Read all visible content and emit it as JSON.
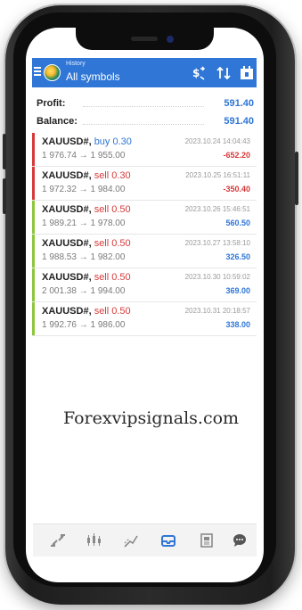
{
  "header": {
    "subtitle": "History",
    "title": "All symbols",
    "actions": [
      "currency-exchange-icon",
      "sort-icon",
      "calendar-icon"
    ]
  },
  "summary": {
    "profit_label": "Profit:",
    "profit_value": "591.40",
    "balance_label": "Balance:",
    "balance_value": "591.40"
  },
  "trades": [
    {
      "symbol": "XAUUSD#,",
      "side": "buy 0.30",
      "side_type": "buy",
      "prices": "1 976.74 → 1 955.00",
      "time": "2023.10.24 14:04:43",
      "profit": "-652.20",
      "profit_color": "#d63a3a",
      "bar_color": "#d63a3a"
    },
    {
      "symbol": "XAUUSD#,",
      "side": "sell 0.30",
      "side_type": "sell",
      "prices": "1 972.32 → 1 984.00",
      "time": "2023.10.25 16:51:11",
      "profit": "-350.40",
      "profit_color": "#d63a3a",
      "bar_color": "#d63a3a"
    },
    {
      "symbol": "XAUUSD#,",
      "side": "sell 0.50",
      "side_type": "sell",
      "prices": "1 989.21 → 1 978.00",
      "time": "2023.10.26 15:46:51",
      "profit": "560.50",
      "profit_color": "#2f76d6",
      "bar_color": "#8dc63f"
    },
    {
      "symbol": "XAUUSD#,",
      "side": "sell 0.50",
      "side_type": "sell",
      "prices": "1 988.53 → 1 982.00",
      "time": "2023.10.27 13:58:10",
      "profit": "326.50",
      "profit_color": "#2f76d6",
      "bar_color": "#8dc63f"
    },
    {
      "symbol": "XAUUSD#,",
      "side": "sell 0.50",
      "side_type": "sell",
      "prices": "2 001.38 → 1 994.00",
      "time": "2023.10.30 10:59:02",
      "profit": "369.00",
      "profit_color": "#2f76d6",
      "bar_color": "#8dc63f"
    },
    {
      "symbol": "XAUUSD#,",
      "side": "sell 0.50",
      "side_type": "sell",
      "prices": "1 992.76 → 1 986.00",
      "time": "2023.10.31 20:18:57",
      "profit": "338.00",
      "profit_color": "#2f76d6",
      "bar_color": "#8dc63f"
    }
  ],
  "watermark": "Forexvipsignals.com",
  "bottom_nav": [
    "quotes-icon",
    "chart-icon",
    "trade-icon",
    "history-icon",
    "news-icon",
    "chat-icon"
  ],
  "colors": {
    "accent": "#2f76d6",
    "loss": "#d63a3a",
    "win_bar": "#8dc63f"
  }
}
